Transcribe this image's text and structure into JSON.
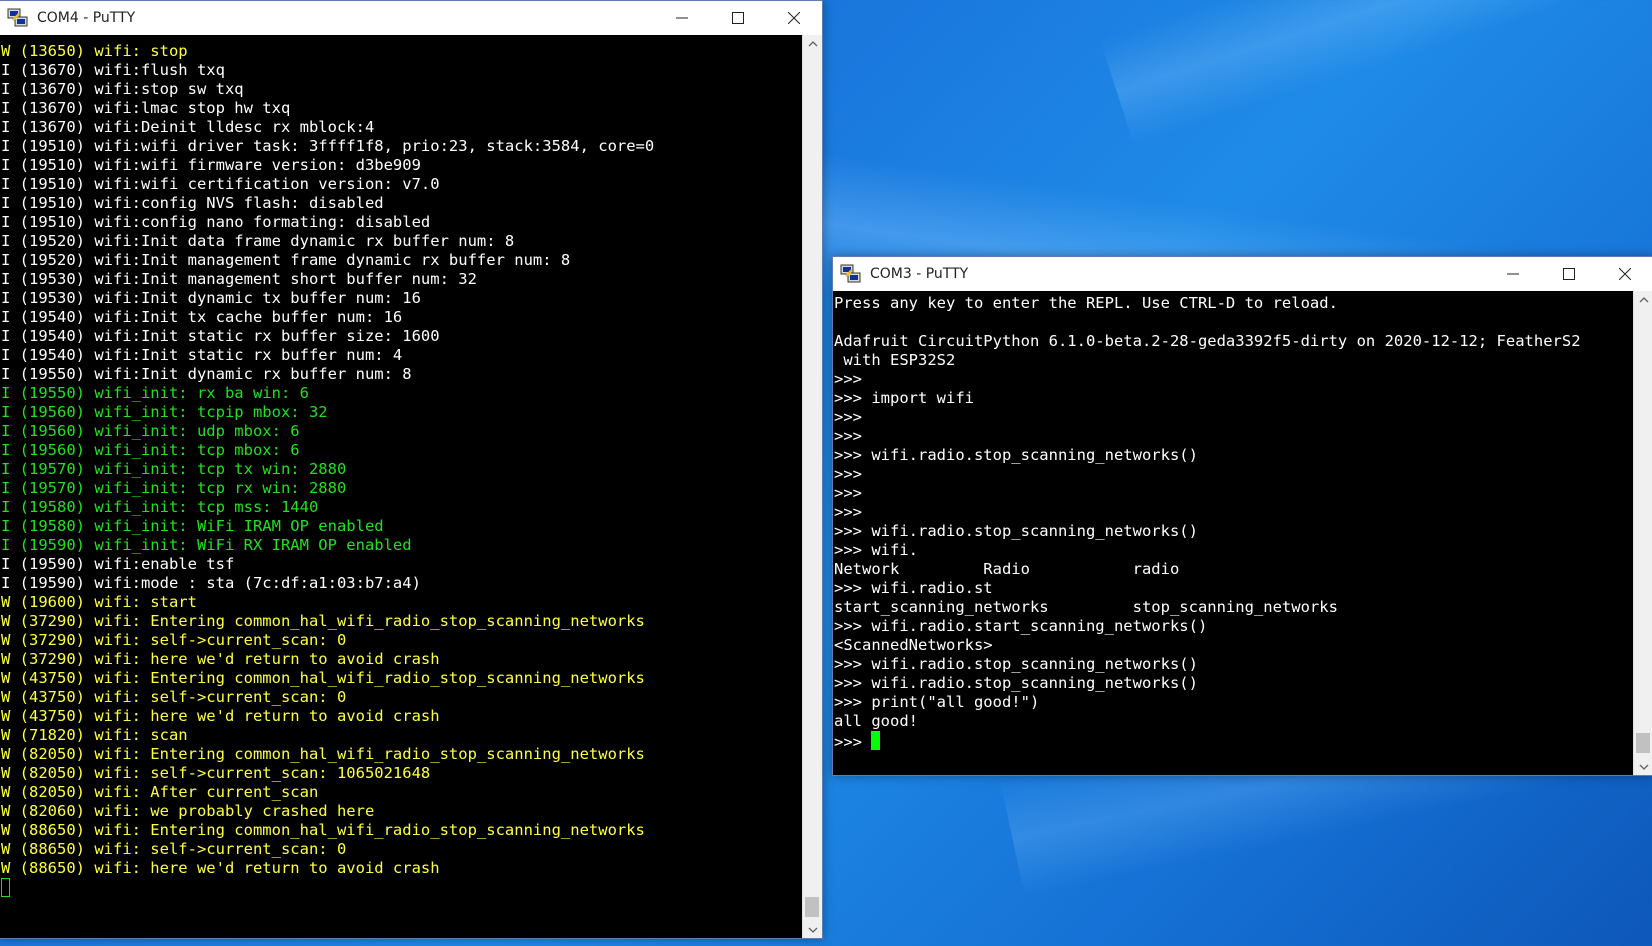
{
  "windows": {
    "com4": {
      "title": "COM4 - PuTTY",
      "lines": [
        {
          "cls": "w",
          "text": "W (13650) wifi: stop"
        },
        {
          "cls": "i",
          "text": "I (13670) wifi:flush txq"
        },
        {
          "cls": "i",
          "text": "I (13670) wifi:stop sw txq"
        },
        {
          "cls": "i",
          "text": "I (13670) wifi:lmac stop hw txq"
        },
        {
          "cls": "i",
          "text": "I (13670) wifi:Deinit lldesc rx mblock:4"
        },
        {
          "cls": "i",
          "text": "I (19510) wifi:wifi driver task: 3ffff1f8, prio:23, stack:3584, core=0"
        },
        {
          "cls": "i",
          "text": "I (19510) wifi:wifi firmware version: d3be909"
        },
        {
          "cls": "i",
          "text": "I (19510) wifi:wifi certification version: v7.0"
        },
        {
          "cls": "i",
          "text": "I (19510) wifi:config NVS flash: disabled"
        },
        {
          "cls": "i",
          "text": "I (19510) wifi:config nano formating: disabled"
        },
        {
          "cls": "i",
          "text": "I (19520) wifi:Init data frame dynamic rx buffer num: 8"
        },
        {
          "cls": "i",
          "text": "I (19520) wifi:Init management frame dynamic rx buffer num: 8"
        },
        {
          "cls": "i",
          "text": "I (19530) wifi:Init management short buffer num: 32"
        },
        {
          "cls": "i",
          "text": "I (19530) wifi:Init dynamic tx buffer num: 16"
        },
        {
          "cls": "i",
          "text": "I (19540) wifi:Init tx cache buffer num: 16"
        },
        {
          "cls": "i",
          "text": "I (19540) wifi:Init static rx buffer size: 1600"
        },
        {
          "cls": "i",
          "text": "I (19540) wifi:Init static rx buffer num: 4"
        },
        {
          "cls": "i",
          "text": "I (19550) wifi:Init dynamic rx buffer num: 8"
        },
        {
          "cls": "g",
          "text": "I (19550) wifi_init: rx ba win: 6"
        },
        {
          "cls": "g",
          "text": "I (19560) wifi_init: tcpip mbox: 32"
        },
        {
          "cls": "g",
          "text": "I (19560) wifi_init: udp mbox: 6"
        },
        {
          "cls": "g",
          "text": "I (19560) wifi_init: tcp mbox: 6"
        },
        {
          "cls": "g",
          "text": "I (19570) wifi_init: tcp tx win: 2880"
        },
        {
          "cls": "g",
          "text": "I (19570) wifi_init: tcp rx win: 2880"
        },
        {
          "cls": "g",
          "text": "I (19580) wifi_init: tcp mss: 1440"
        },
        {
          "cls": "g",
          "text": "I (19580) wifi_init: WiFi IRAM OP enabled"
        },
        {
          "cls": "g",
          "text": "I (19590) wifi_init: WiFi RX IRAM OP enabled"
        },
        {
          "cls": "i",
          "text": "I (19590) wifi:enable tsf"
        },
        {
          "cls": "i",
          "text": "I (19590) wifi:mode : sta (7c:df:a1:03:b7:a4)"
        },
        {
          "cls": "w",
          "text": "W (19600) wifi: start"
        },
        {
          "cls": "w",
          "text": "W (37290) wifi: Entering common_hal_wifi_radio_stop_scanning_networks"
        },
        {
          "cls": "w",
          "text": "W (37290) wifi: self->current_scan: 0"
        },
        {
          "cls": "w",
          "text": "W (37290) wifi: here we'd return to avoid crash"
        },
        {
          "cls": "w",
          "text": "W (43750) wifi: Entering common_hal_wifi_radio_stop_scanning_networks"
        },
        {
          "cls": "w",
          "text": "W (43750) wifi: self->current_scan: 0"
        },
        {
          "cls": "w",
          "text": "W (43750) wifi: here we'd return to avoid crash"
        },
        {
          "cls": "w",
          "text": "W (71820) wifi: scan"
        },
        {
          "cls": "w",
          "text": "W (82050) wifi: Entering common_hal_wifi_radio_stop_scanning_networks"
        },
        {
          "cls": "w",
          "text": "W (82050) wifi: self->current_scan: 1065021648"
        },
        {
          "cls": "w",
          "text": "W (82050) wifi: After current_scan"
        },
        {
          "cls": "w",
          "text": "W (82060) wifi: we probably crashed here"
        },
        {
          "cls": "w",
          "text": "W (88650) wifi: Entering common_hal_wifi_radio_stop_scanning_networks"
        },
        {
          "cls": "w",
          "text": "W (88650) wifi: self->current_scan: 0"
        },
        {
          "cls": "w",
          "text": "W (88650) wifi: here we'd return to avoid crash"
        }
      ]
    },
    "com3": {
      "title": "COM3 - PuTTY",
      "lines": [
        "Press any key to enter the REPL. Use CTRL-D to reload.",
        "",
        "Adafruit CircuitPython 6.1.0-beta.2-28-geda3392f5-dirty on 2020-12-12; FeatherS2",
        " with ESP32S2",
        ">>>",
        ">>> import wifi",
        ">>>",
        ">>>",
        ">>> wifi.radio.stop_scanning_networks()",
        ">>>",
        ">>>",
        ">>>",
        ">>> wifi.radio.stop_scanning_networks()",
        ">>> wifi.",
        "Network         Radio           radio",
        ">>> wifi.radio.st",
        "start_scanning_networks         stop_scanning_networks",
        ">>> wifi.radio.start_scanning_networks()",
        "<ScannedNetworks>",
        ">>> wifi.radio.stop_scanning_networks()",
        ">>> wifi.radio.stop_scanning_networks()",
        ">>> print(\"all good!\")",
        "all good!"
      ],
      "prompt": ">>> "
    }
  },
  "colors": {
    "warn": "#ffff40",
    "info": "#ffffff",
    "green": "#20e020",
    "cursor": "#00ff00"
  },
  "icons": [
    "putty-icon",
    "minimize-icon",
    "maximize-icon",
    "close-icon",
    "scroll-up-icon",
    "scroll-down-icon"
  ]
}
